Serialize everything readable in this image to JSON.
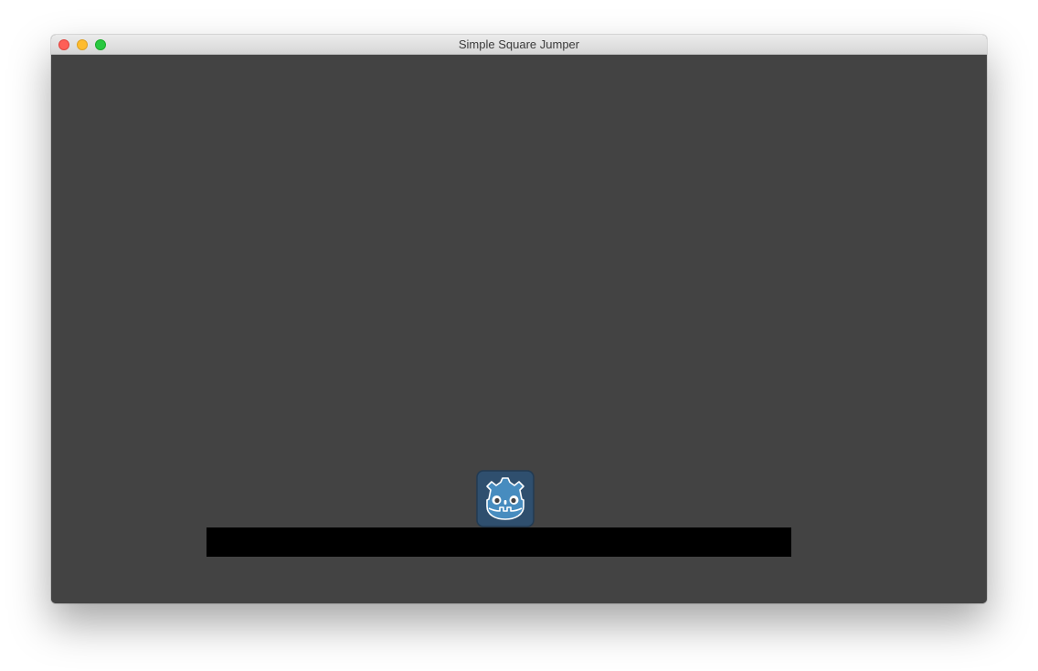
{
  "window": {
    "title": "Simple Square Jumper"
  },
  "titlebar": {
    "buttons": [
      "close",
      "minimize",
      "maximize"
    ]
  },
  "game": {
    "background_color": "#434343",
    "platform_color": "#000000",
    "player_sprite": "godot-logo-icon",
    "player_colors": {
      "body": "#478cbf",
      "frame": "#2f4f6e",
      "outline": "#ffffff"
    }
  }
}
